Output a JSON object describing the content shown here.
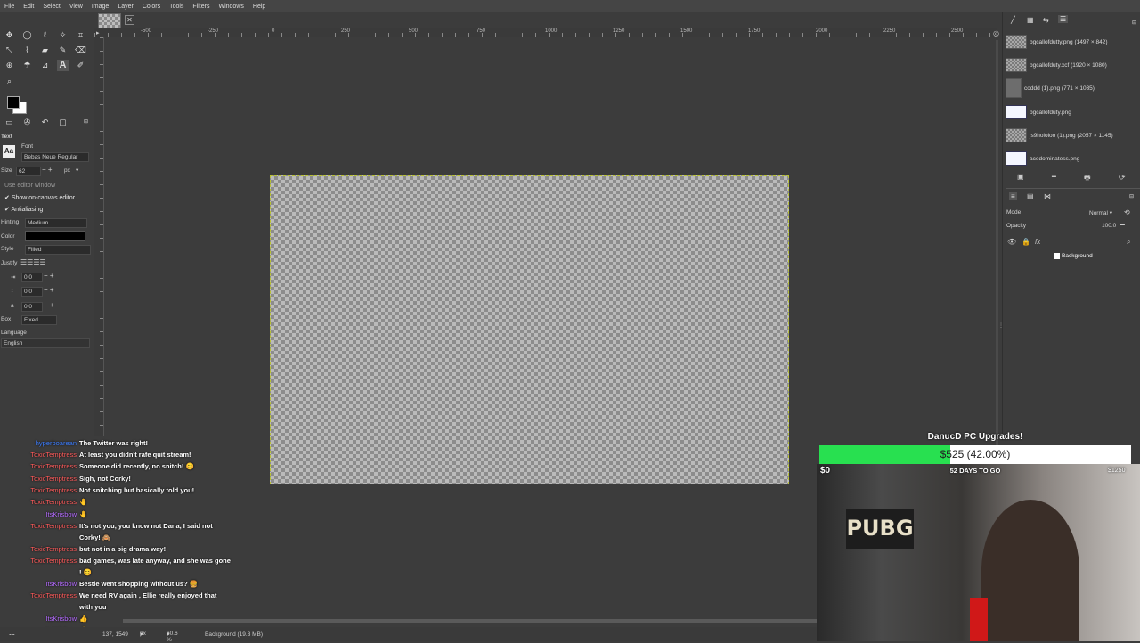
{
  "menu": [
    "File",
    "Edit",
    "Select",
    "View",
    "Image",
    "Layer",
    "Colors",
    "Tools",
    "Filters",
    "Windows",
    "Help"
  ],
  "tool_options": {
    "section_title": "Text",
    "font_label": "Font",
    "font_value": "Bebas Neue Regular",
    "size_label": "Size",
    "size_value": "62",
    "size_unit": "px",
    "use_editor_window": "Use editor window",
    "show_on_canvas_editor": "Show on-canvas editor",
    "antialiasing": "Antialiasing",
    "hinting_label": "Hinting",
    "hinting_value": "Medium",
    "color_label": "Color",
    "style_label": "Style",
    "style_value": "Filled",
    "justify_label": "Justify",
    "indent_value": "0.0",
    "line_spacing_value": "0.0",
    "letter_spacing_value": "0.0",
    "box_label": "Box",
    "box_value": "Fixed",
    "language_label": "Language",
    "language_value": "English"
  },
  "ruler_ticks": [
    "-500",
    "-250",
    "0",
    "250",
    "500",
    "750",
    "1000",
    "1250",
    "1500",
    "1750",
    "2000",
    "2250",
    "2500"
  ],
  "images_panel": [
    {
      "label": "bgcallofdutty.png (1497 × 842)",
      "thumb": "checker"
    },
    {
      "label": "bgcallofduty.xcf (1920 × 1080)",
      "thumb": "checker"
    },
    {
      "label": "coddd (1).png (771 × 1035)",
      "thumb": "photo"
    },
    {
      "label": "bgcallofduty.png",
      "thumb": "blue"
    },
    {
      "label": "js9hololoo (1).png (2057 × 1145)",
      "thumb": "checker"
    },
    {
      "label": "acedominatess.png",
      "thumb": "blue"
    }
  ],
  "layers_panel": {
    "mode_label": "Mode",
    "mode_value": "Normal",
    "opacity_label": "Opacity",
    "opacity_value": "100.0",
    "layer_name": "Background"
  },
  "chat": [
    {
      "user": "hyperboarean",
      "color": "#3b7dff",
      "text": "The Twitter was right!"
    },
    {
      "user": "ToxicTemptress",
      "color": "#ff5a5a",
      "text": "At least you didn't rafe quit stream!"
    },
    {
      "user": "ToxicTemptress",
      "color": "#ff5a5a",
      "text": "Someone did recently, no snitch! 😊"
    },
    {
      "user": "ToxicTemptress",
      "color": "#ff5a5a",
      "text": "Sigh, not Corky!"
    },
    {
      "user": "ToxicTemptress",
      "color": "#ff5a5a",
      "text": "Not snitching but basically told you!"
    },
    {
      "user": "ToxicTemptress",
      "color": "#ff5a5a",
      "text": "🤚"
    },
    {
      "user": "ItsKrisbow",
      "color": "#b46bff",
      "text": "🤚"
    },
    {
      "user": "ToxicTemptress",
      "color": "#ff5a5a",
      "text": "It's not you, you know not Dana, I said not"
    },
    {
      "user": "",
      "color": "#ff5a5a",
      "text": "Corky! 🙈"
    },
    {
      "user": "ToxicTemptress",
      "color": "#ff5a5a",
      "text": "but not in a big drama way!"
    },
    {
      "user": "ToxicTemptress",
      "color": "#ff5a5a",
      "text": "bad games, was late anyway, and she was gone"
    },
    {
      "user": "",
      "color": "#ff5a5a",
      "text": "! 😊"
    },
    {
      "user": "ItsKrisbow",
      "color": "#b46bff",
      "text": "Bestie went shopping without us? 🍔"
    },
    {
      "user": "ToxicTemptress",
      "color": "#ff5a5a",
      "text": "We need RV again , Ellie really enjoyed that"
    },
    {
      "user": "",
      "color": "#ff5a5a",
      "text": "with you"
    },
    {
      "user": "ItsKrisbow",
      "color": "#b46bff",
      "text": "👍"
    },
    {
      "user": "ItsKrisbow",
      "color": "#b46bff",
      "text": "👍"
    }
  ],
  "donation": {
    "title": "DanucD PC Upgrades!",
    "amount": "$525 (42.00%)",
    "progress": 0.42,
    "min": "$0",
    "max": "$1250",
    "days_left": "52 DAYS TO GO"
  },
  "statusbar": {
    "coords": "137, 1549",
    "unit": "px",
    "zoom": "60.6 %",
    "layer_info": "Background (19.3 MB)"
  }
}
